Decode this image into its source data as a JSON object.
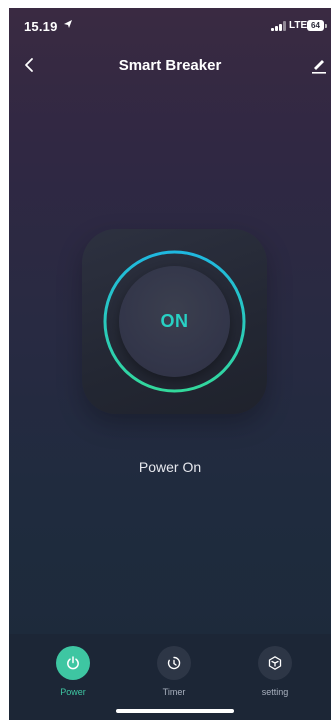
{
  "status_bar": {
    "time": "15.19",
    "network": "LTE",
    "battery": "64"
  },
  "header": {
    "title": "Smart Breaker"
  },
  "power": {
    "state_label": "ON",
    "status_text": "Power On"
  },
  "tabs": [
    {
      "label": "Power",
      "icon": "power-icon",
      "active": true
    },
    {
      "label": "Timer",
      "icon": "timer-icon",
      "active": false
    },
    {
      "label": "setting",
      "icon": "settings-icon",
      "active": false
    }
  ],
  "colors": {
    "accent": "#3ec6a2",
    "ring_start": "#1fb8e0",
    "ring_end": "#33d99c",
    "on_text": "#28d1c4"
  }
}
